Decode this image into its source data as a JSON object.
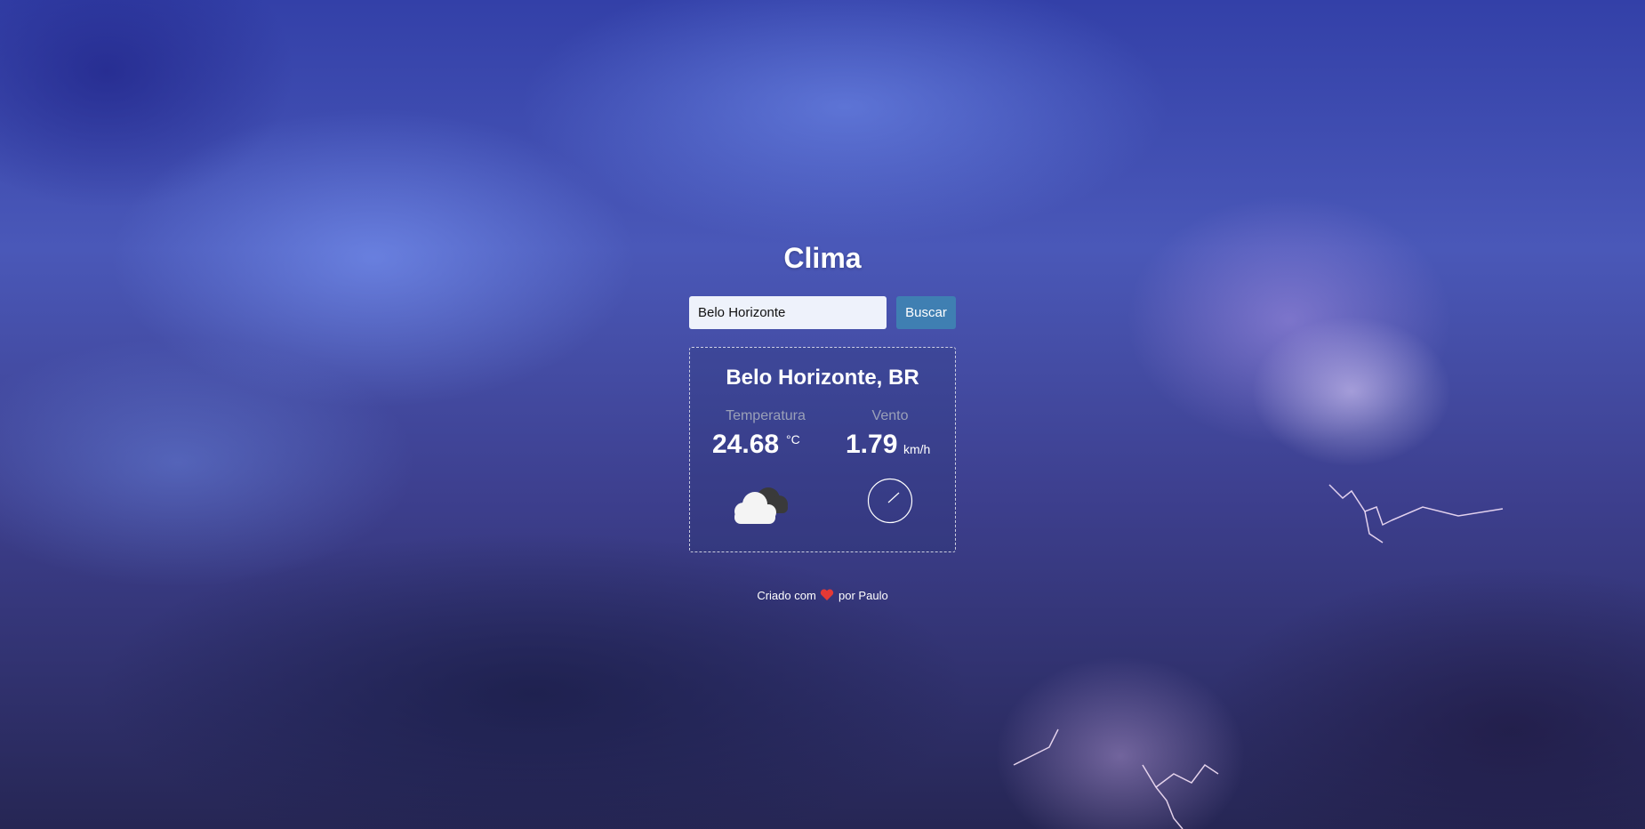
{
  "app": {
    "title": "Clima"
  },
  "search": {
    "value": "Belo Horizonte",
    "button_label": "Buscar"
  },
  "weather": {
    "location": "Belo Horizonte, BR",
    "temperature_label": "Temperatura",
    "temperature_value": "24.68",
    "temperature_unit": "°C",
    "wind_label": "Vento",
    "wind_value": "1.79",
    "wind_unit": "km/h",
    "condition_icon": "cloudy-icon",
    "wind_direction_icon": "wind-compass-icon"
  },
  "footer": {
    "prefix": "Criado com",
    "suffix": "por Paulo",
    "heart_icon": "heart-icon"
  },
  "colors": {
    "button": "#3f7fb2",
    "input_bg": "#eef2fb",
    "heart": "#e53935"
  }
}
